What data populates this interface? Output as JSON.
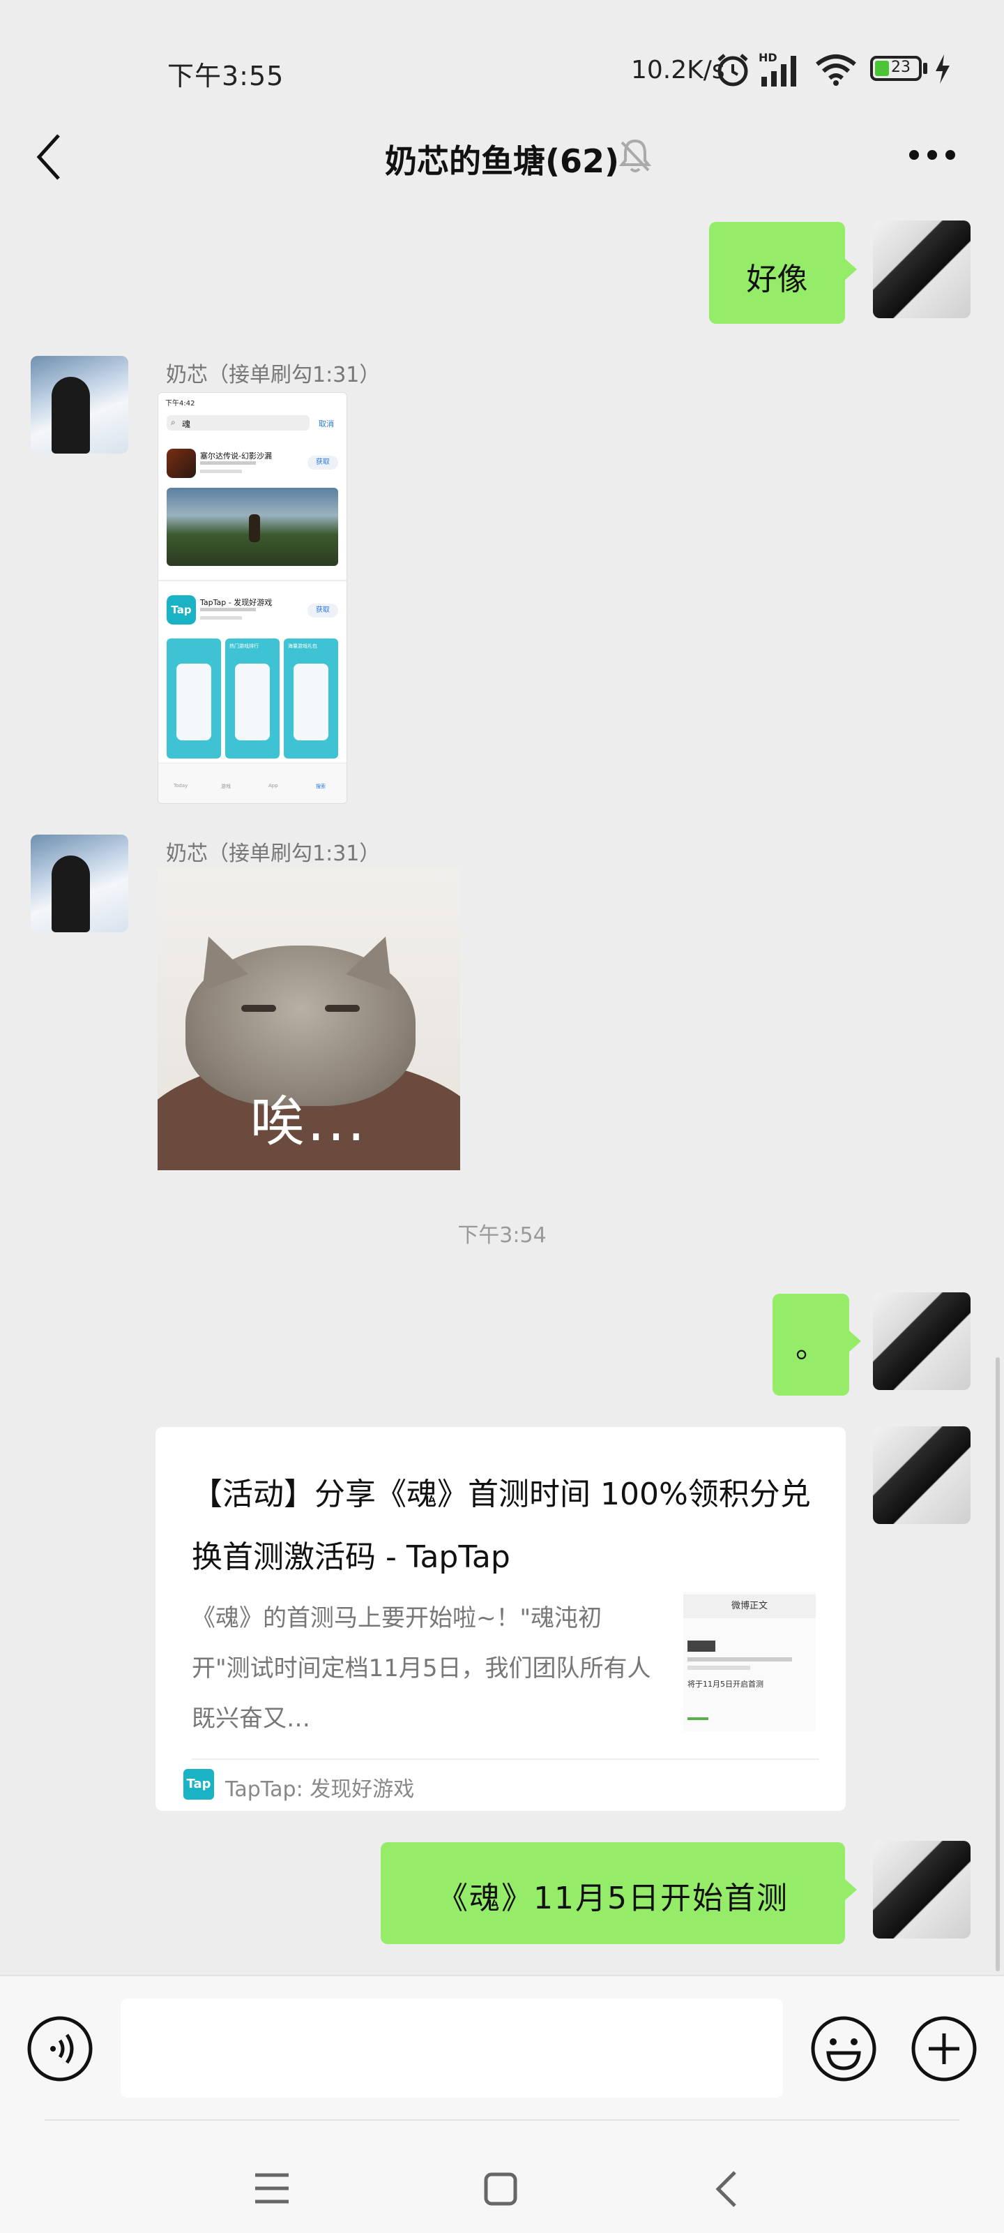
{
  "status": {
    "time": "下午3:55",
    "network_speed": "10.2K/s",
    "battery": "23"
  },
  "header": {
    "title": "奶芯的鱼塘(62)",
    "back_icon": "chevron-left-icon",
    "mute_icon": "bell-off-icon",
    "more_icon": "more-dots-icon"
  },
  "messages": [
    {
      "from": "me",
      "text": "好像"
    },
    {
      "from": "other",
      "sender": "奶芯（接单刷勾1:31）",
      "type": "image",
      "image": "app-store-screenshot",
      "image_texts": {
        "status": "下午4:42",
        "search_query": "魂",
        "cancel": "取消",
        "app1_name": "塞尔达传说-幻影沙漏",
        "app1_button": "获取",
        "app2_name": "TapTap - 发现好游戏",
        "app2_button": "获取",
        "tap_logo": "Tap",
        "promo1": "热门游戏排行",
        "promo2": "海量游戏礼包",
        "tabs": [
          "Today",
          "游戏",
          "App",
          "搜索"
        ]
      }
    },
    {
      "from": "other",
      "sender": "奶芯（接单刷勾1:31）",
      "type": "sticker",
      "caption": "唉..."
    },
    {
      "from": "system",
      "text": "下午3:54"
    },
    {
      "from": "me",
      "text": "。"
    },
    {
      "from": "me",
      "type": "link_card",
      "title": "【活动】分享《魂》首测时间 100%领积分兑换首测激活码 - TapTap",
      "desc": "《魂》的首测马上要开始啦~！\"魂沌初开\"测试时间定档11月5日，我们团队所有人既兴奋又…",
      "thumb_label": "微博正文",
      "thumb_line": "将于11月5日开启首测",
      "source_logo": "Tap",
      "source": "TapTap: 发现好游戏"
    },
    {
      "from": "me",
      "text": "《魂》11月5日开始首测"
    }
  ],
  "input": {
    "voice_icon": "voice-icon",
    "text_value": "",
    "emoji_icon": "emoji-icon",
    "plus_icon": "plus-icon"
  },
  "nav": {
    "menu_icon": "menu-icon",
    "home_icon": "home-square-icon",
    "back_icon": "back-triangle-icon"
  },
  "colors": {
    "background": "#ededed",
    "bubble_green": "#95ec69",
    "bubble_white": "#ffffff",
    "tap_cyan": "#1ab3c6"
  }
}
